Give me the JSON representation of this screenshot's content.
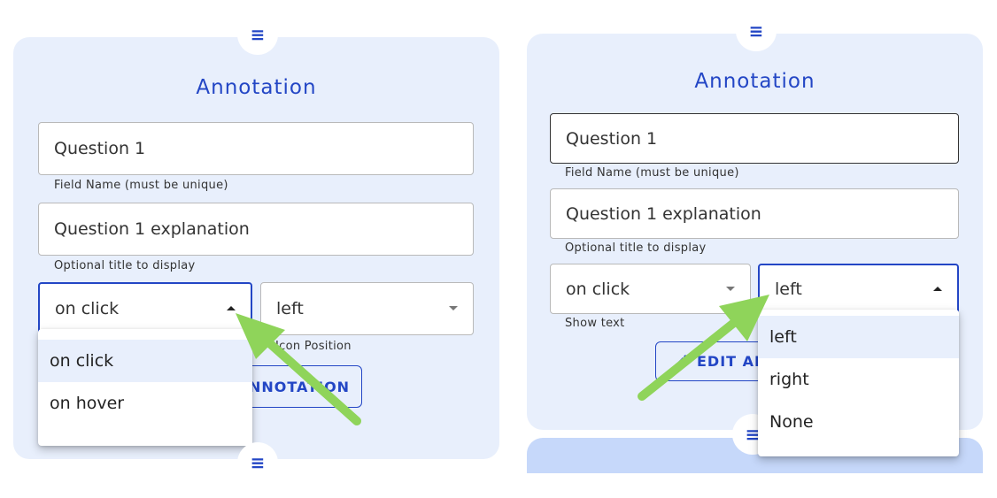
{
  "left_panel": {
    "title": "Annotation",
    "field_name": {
      "value": "Question 1",
      "helper": "Field Name (must be unique)"
    },
    "title_field": {
      "value": "Question 1 explanation",
      "helper": "Optional title to display"
    },
    "show_select": {
      "value": "on click"
    },
    "position_select": {
      "value": "left",
      "helper": "Icon Position"
    },
    "button_label": "NNOTATION",
    "menu": [
      "on click",
      "on hover"
    ]
  },
  "right_panel": {
    "title": "Annotation",
    "field_name": {
      "value": "Question 1",
      "helper": "Field Name (must be unique)"
    },
    "title_field": {
      "value": "Question 1 explanation",
      "helper": "Optional title to display"
    },
    "show_select": {
      "value": "on click",
      "helper": "Show text"
    },
    "position_select": {
      "value": "left"
    },
    "button_label": "EDIT AN",
    "menu": [
      "left",
      "right",
      "None"
    ]
  },
  "handle_icon": "drag-handle-icon",
  "pencil_icon": "pencil-icon",
  "colors": {
    "accent": "#2346c5",
    "panel": "#e8effc",
    "arrow": "#8fd45a"
  }
}
